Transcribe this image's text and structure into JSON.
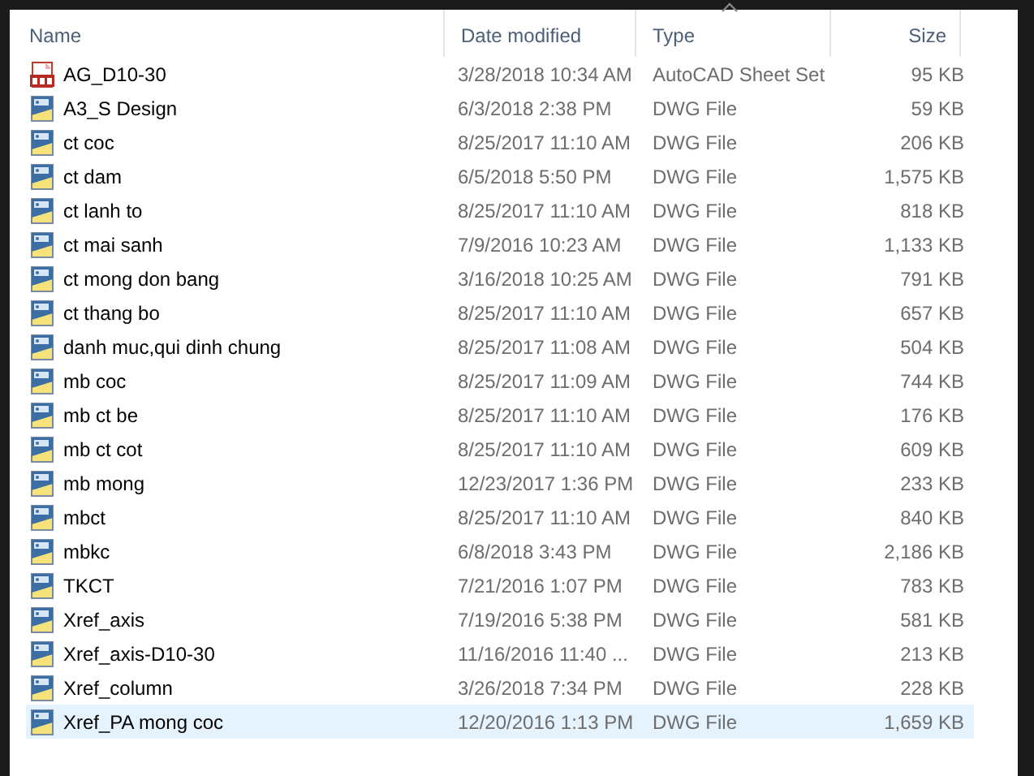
{
  "columns": [
    {
      "label": "Name",
      "sorted": false
    },
    {
      "label": "Date modified",
      "sorted": false
    },
    {
      "label": "Type",
      "sorted": true
    },
    {
      "label": "Size",
      "sorted": false
    }
  ],
  "rows": [
    {
      "kind": "dst",
      "name": "AG_D10-30",
      "date": "3/28/2018 10:34 AM",
      "type": "AutoCAD Sheet Set",
      "size": "95 KB",
      "hovered": false
    },
    {
      "kind": "dwg",
      "name": "A3_S Design",
      "date": "6/3/2018 2:38 PM",
      "type": "DWG File",
      "size": "59 KB",
      "hovered": false
    },
    {
      "kind": "dwg",
      "name": "ct coc",
      "date": "8/25/2017 11:10 AM",
      "type": "DWG File",
      "size": "206 KB",
      "hovered": false
    },
    {
      "kind": "dwg",
      "name": "ct dam",
      "date": "6/5/2018 5:50 PM",
      "type": "DWG File",
      "size": "1,575 KB",
      "hovered": false
    },
    {
      "kind": "dwg",
      "name": "ct lanh to",
      "date": "8/25/2017 11:10 AM",
      "type": "DWG File",
      "size": "818 KB",
      "hovered": false
    },
    {
      "kind": "dwg",
      "name": "ct mai sanh",
      "date": "7/9/2016 10:23 AM",
      "type": "DWG File",
      "size": "1,133 KB",
      "hovered": false
    },
    {
      "kind": "dwg",
      "name": "ct mong don bang",
      "date": "3/16/2018 10:25 AM",
      "type": "DWG File",
      "size": "791 KB",
      "hovered": false
    },
    {
      "kind": "dwg",
      "name": "ct thang bo",
      "date": "8/25/2017 11:10 AM",
      "type": "DWG File",
      "size": "657 KB",
      "hovered": false
    },
    {
      "kind": "dwg",
      "name": "danh muc,qui dinh chung",
      "date": "8/25/2017 11:08 AM",
      "type": "DWG File",
      "size": "504 KB",
      "hovered": false
    },
    {
      "kind": "dwg",
      "name": "mb coc",
      "date": "8/25/2017 11:09 AM",
      "type": "DWG File",
      "size": "744 KB",
      "hovered": false
    },
    {
      "kind": "dwg",
      "name": "mb ct be",
      "date": "8/25/2017 11:10 AM",
      "type": "DWG File",
      "size": "176 KB",
      "hovered": false
    },
    {
      "kind": "dwg",
      "name": "mb ct cot",
      "date": "8/25/2017 11:10 AM",
      "type": "DWG File",
      "size": "609 KB",
      "hovered": false
    },
    {
      "kind": "dwg",
      "name": "mb mong",
      "date": "12/23/2017 1:36 PM",
      "type": "DWG File",
      "size": "233 KB",
      "hovered": false
    },
    {
      "kind": "dwg",
      "name": "mbct",
      "date": "8/25/2017 11:10 AM",
      "type": "DWG File",
      "size": "840 KB",
      "hovered": false
    },
    {
      "kind": "dwg",
      "name": "mbkc",
      "date": "6/8/2018 3:43 PM",
      "type": "DWG File",
      "size": "2,186 KB",
      "hovered": false
    },
    {
      "kind": "dwg",
      "name": "TKCT",
      "date": "7/21/2016 1:07 PM",
      "type": "DWG File",
      "size": "783 KB",
      "hovered": false
    },
    {
      "kind": "dwg",
      "name": "Xref_axis",
      "date": "7/19/2016 5:38 PM",
      "type": "DWG File",
      "size": "581 KB",
      "hovered": false
    },
    {
      "kind": "dwg",
      "name": "Xref_axis-D10-30",
      "date": "11/16/2016 11:40 ...",
      "type": "DWG File",
      "size": "213 KB",
      "hovered": false
    },
    {
      "kind": "dwg",
      "name": "Xref_column",
      "date": "3/26/2018 7:34 PM",
      "type": "DWG File",
      "size": "228 KB",
      "hovered": false
    },
    {
      "kind": "dwg",
      "name": "Xref_PA mong coc",
      "date": "12/20/2016 1:13 PM",
      "type": "DWG File",
      "size": "1,659 KB",
      "hovered": true
    }
  ]
}
